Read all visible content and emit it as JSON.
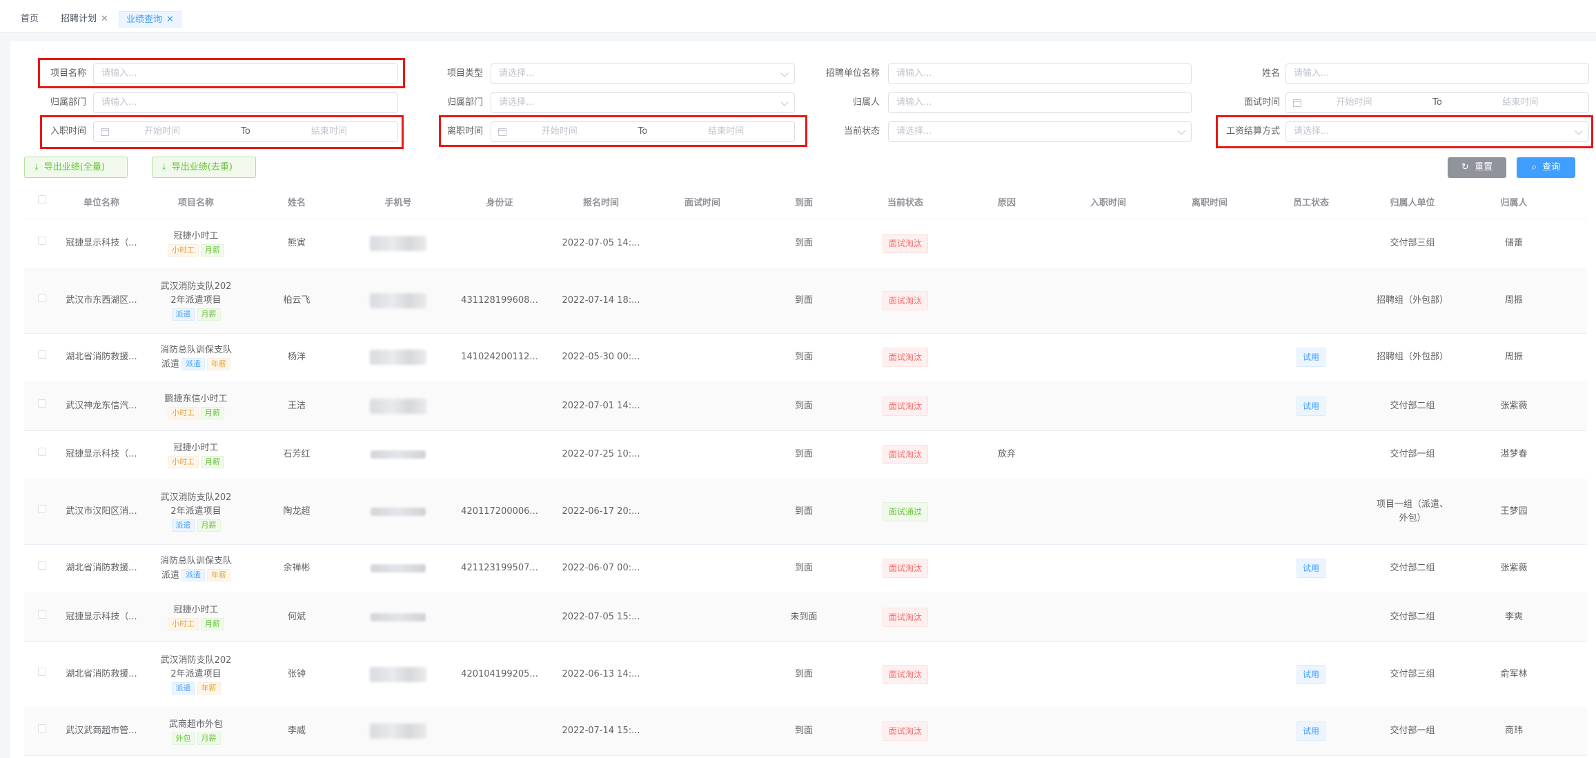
{
  "tabs": [
    {
      "label": "首页",
      "closable": false,
      "active": false
    },
    {
      "label": "招聘计划",
      "closable": true,
      "active": false
    },
    {
      "label": "业绩查询",
      "closable": true,
      "active": true
    }
  ],
  "filters": {
    "project_name": {
      "label": "项目名称",
      "placeholder": "请输入..."
    },
    "project_type": {
      "label": "项目类型",
      "placeholder": "请选择..."
    },
    "employer_name": {
      "label": "招聘单位名称",
      "placeholder": "请输入..."
    },
    "name": {
      "label": "姓名",
      "placeholder": "请输入..."
    },
    "department": {
      "label": "归属部门",
      "placeholder": "请输入..."
    },
    "owner_department": {
      "label": "归属部门",
      "placeholder": "请选择..."
    },
    "owner": {
      "label": "归属人",
      "placeholder": "请输入..."
    },
    "interview_time": {
      "label": "面试时间",
      "start": "开始时间",
      "to": "To",
      "end": "结束时间"
    },
    "entry_time": {
      "label": "入职时间",
      "start": "开始时间",
      "to": "To",
      "end": "结束时间"
    },
    "leave_time": {
      "label": "离职时间",
      "start": "开始时间",
      "to": "To",
      "end": "结束时间"
    },
    "current_status": {
      "label": "当前状态",
      "placeholder": "请选择..."
    },
    "salary_method": {
      "label": "工资结算方式",
      "placeholder": "请选择..."
    }
  },
  "actions": {
    "export_all": "导出业绩(全量)",
    "export_dedup": "导出业绩(去重)",
    "reset": "重置",
    "search": "查询"
  },
  "columns": [
    "单位名称",
    "项目名称",
    "姓名",
    "手机号",
    "身份证",
    "报名时间",
    "面试时间",
    "到面",
    "当前状态",
    "原因",
    "入职时间",
    "离职时间",
    "员工状态",
    "归属人单位",
    "归属人"
  ],
  "rows": [
    {
      "company": "冠捷显示科技（...",
      "project": [
        "冠捷小时工"
      ],
      "tags": [
        [
          "小时工",
          "orange"
        ],
        [
          "月薪",
          "green"
        ]
      ],
      "name": "熊寅",
      "id": "",
      "signup": "2022-07-05 14:...",
      "arrive": "到面",
      "status": "面试淘汰",
      "status_color": "red",
      "reason": "",
      "emp_status": "",
      "owner_unit": [
        "交付部三组"
      ],
      "owner": "储蕾"
    },
    {
      "company": "武汉市东西湖区...",
      "project": [
        "武汉消防支队202",
        "2年派遣项目"
      ],
      "tags": [
        [
          "派遣",
          "blue"
        ],
        [
          "月薪",
          "green"
        ]
      ],
      "name": "柏云飞",
      "id": "431128199608...",
      "signup": "2022-07-14 18:...",
      "arrive": "到面",
      "status": "面试淘汰",
      "status_color": "red",
      "reason": "",
      "emp_status": "",
      "owner_unit": [
        "招聘组（外包部）"
      ],
      "owner": "周振"
    },
    {
      "company": "湖北省消防救援...",
      "project": [
        "消防总队训保支队",
        "派遣"
      ],
      "tags": [
        [
          "派遣",
          "blue"
        ],
        [
          "年薪",
          "orange"
        ]
      ],
      "name": "杨洋",
      "id": "141024200112...",
      "signup": "2022-05-30 00:...",
      "arrive": "到面",
      "status": "面试淘汰",
      "status_color": "red",
      "reason": "",
      "emp_status": "试用",
      "owner_unit": [
        "招聘组（外包部）"
      ],
      "owner": "周振"
    },
    {
      "company": "武汉神龙东信汽...",
      "project": [
        "鹏捷东信小时工"
      ],
      "tags": [
        [
          "小时工",
          "orange"
        ],
        [
          "月薪",
          "green"
        ]
      ],
      "name": "王洁",
      "id": "",
      "signup": "2022-07-01 14:...",
      "arrive": "到面",
      "status": "面试淘汰",
      "status_color": "red",
      "reason": "",
      "emp_status": "试用",
      "owner_unit": [
        "交付部二组"
      ],
      "owner": "张紫薇"
    },
    {
      "company": "冠捷显示科技（...",
      "project": [
        "冠捷小时工"
      ],
      "tags": [
        [
          "小时工",
          "orange"
        ],
        [
          "月薪",
          "green"
        ]
      ],
      "name": "石芳红",
      "id": "",
      "signup": "2022-07-25 10:...",
      "arrive": "到面",
      "status": "面试淘汰",
      "status_color": "red",
      "reason": "放弃",
      "emp_status": "",
      "owner_unit": [
        "交付部一组"
      ],
      "owner": "湛梦春"
    },
    {
      "company": "武汉市汉阳区消...",
      "project": [
        "武汉消防支队202",
        "2年派遣项目"
      ],
      "tags": [
        [
          "派遣",
          "blue"
        ],
        [
          "月薪",
          "green"
        ]
      ],
      "name": "陶龙超",
      "id": "420117200006...",
      "signup": "2022-06-17 20:...",
      "arrive": "到面",
      "status": "面试通过",
      "status_color": "green",
      "reason": "",
      "emp_status": "",
      "owner_unit": [
        "项目一组（派遣、",
        "外包）"
      ],
      "owner": "王梦园"
    },
    {
      "company": "湖北省消防救援...",
      "project": [
        "消防总队训保支队",
        "派遣"
      ],
      "tags": [
        [
          "派遣",
          "blue"
        ],
        [
          "年薪",
          "orange"
        ]
      ],
      "name": "余禅彬",
      "id": "421123199507...",
      "signup": "2022-06-07 00:...",
      "arrive": "到面",
      "status": "面试淘汰",
      "status_color": "red",
      "reason": "",
      "emp_status": "试用",
      "owner_unit": [
        "交付部二组"
      ],
      "owner": "张紫薇"
    },
    {
      "company": "冠捷显示科技（...",
      "project": [
        "冠捷小时工"
      ],
      "tags": [
        [
          "小时工",
          "orange"
        ],
        [
          "月薪",
          "green"
        ]
      ],
      "name": "何斌",
      "id": "",
      "signup": "2022-07-05 15:...",
      "arrive": "未到面",
      "status": "面试淘汰",
      "status_color": "red",
      "reason": "",
      "emp_status": "",
      "owner_unit": [
        "交付部二组"
      ],
      "owner": "李爽"
    },
    {
      "company": "湖北省消防救援...",
      "project": [
        "武汉消防支队202",
        "2年派遣项目"
      ],
      "tags": [
        [
          "派遣",
          "blue"
        ],
        [
          "年薪",
          "orange"
        ]
      ],
      "name": "张钟",
      "id": "420104199205...",
      "signup": "2022-06-13 14:...",
      "arrive": "到面",
      "status": "面试淘汰",
      "status_color": "red",
      "reason": "",
      "emp_status": "试用",
      "owner_unit": [
        "交付部三组"
      ],
      "owner": "俞军林"
    },
    {
      "company": "武汉武商超市管...",
      "project": [
        "武商超市外包"
      ],
      "tags": [
        [
          "外包",
          "green"
        ],
        [
          "月薪",
          "green"
        ]
      ],
      "name": "李威",
      "id": "",
      "signup": "2022-07-14 15:...",
      "arrive": "到面",
      "status": "面试淘汰",
      "status_color": "red",
      "reason": "",
      "emp_status": "试用",
      "owner_unit": [
        "交付部一组"
      ],
      "owner": "商玮"
    }
  ]
}
